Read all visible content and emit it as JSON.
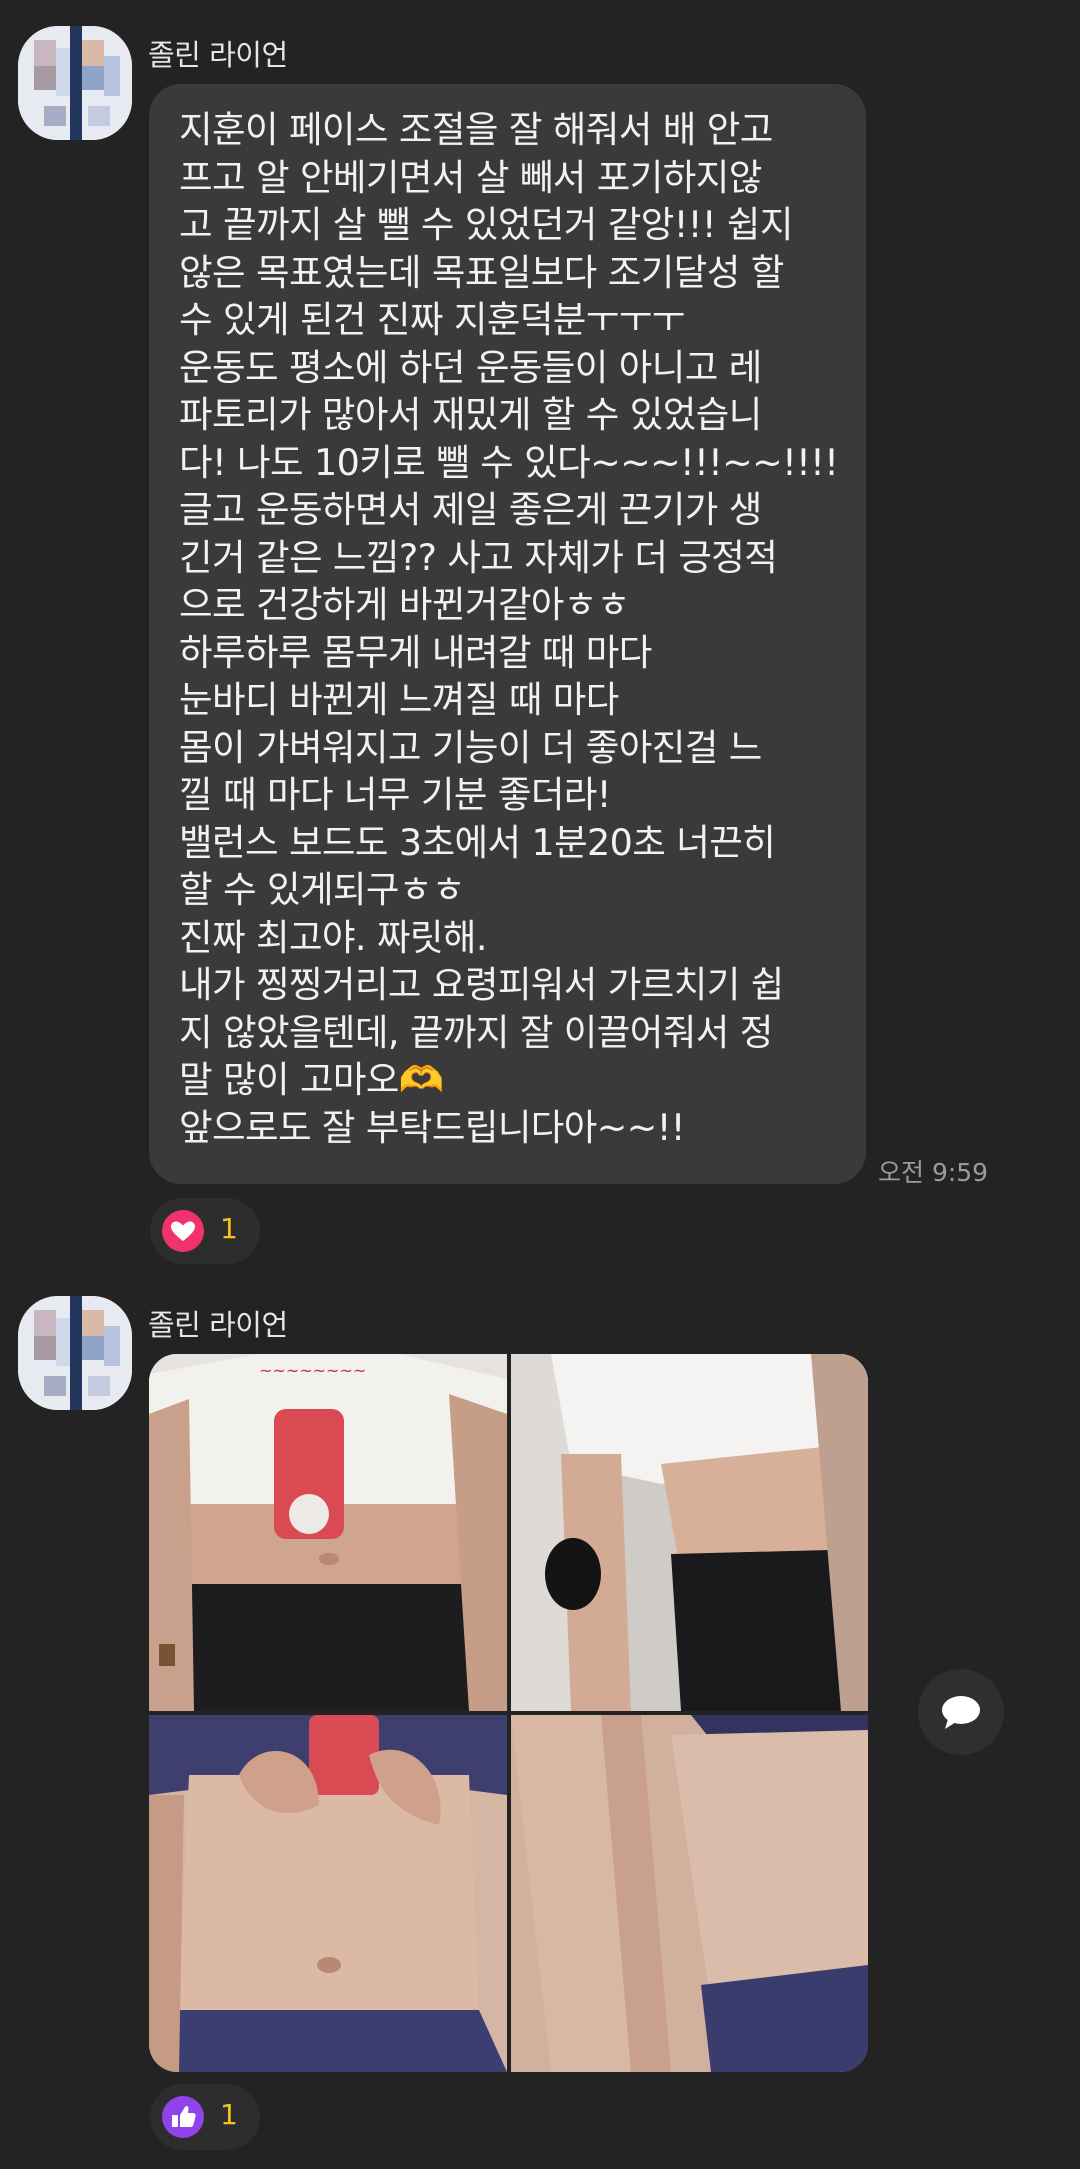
{
  "messages": [
    {
      "sender": "졸린 라이언",
      "lines": [
        "지훈이 페이스 조절을 잘 해줘서 배 안고",
        "프고 알 안베기면서 살 빼서 포기하지않",
        "고 끝까지 살 뺄 수 있었던거 같앙!!! 쉽지",
        "않은 목표였는데 목표일보다 조기달성 할",
        "수 있게 된건 진짜 지훈덕분ㅜㅜㅜ",
        "운동도 평소에 하던 운동들이 아니고 레",
        "파토리가 많아서 재밌게 할 수 있었습니",
        "다! 나도 10키로 뺄 수 있다~~~!!!~~!!!!",
        "글고 운동하면서 제일 좋은게 끈기가 생",
        "긴거 같은 느낌?? 사고 자체가 더 긍정적",
        "으로 건강하게 바뀐거같아ㅎㅎ",
        "하루하루 몸무게 내려갈 때 마다",
        "눈바디 바뀐게 느껴질 때 마다",
        "몸이 가벼워지고 기능이 더 좋아진걸 느",
        "낄 때 마다 너무 기분 좋더라!",
        "밸런스 보드도 3초에서 1분20초 너끈히",
        "할 수 있게되구ㅎㅎ",
        "진짜 최고야. 짜릿해.",
        "내가 찡찡거리고 요령피워서 가르치기 쉽",
        "지 않았을텐데, 끝까지 잘 이끌어줘서 정",
        "말 많이 고마오🫶",
        "앞으로도 잘 부탁드립니다아~~!!"
      ],
      "time": "오전 9:59",
      "reaction": {
        "icon": "heart-icon",
        "count": "1",
        "color": "#f0336d"
      }
    },
    {
      "sender": "졸린 라이언",
      "photos": [
        {
          "name": "photo-front-before"
        },
        {
          "name": "photo-side-before"
        },
        {
          "name": "photo-front-after"
        },
        {
          "name": "photo-side-after"
        }
      ],
      "reaction": {
        "icon": "thumbs-up-icon",
        "count": "1",
        "color": "#8f43e8"
      }
    }
  ],
  "actions": {
    "comment_icon": "speech-bubble-icon"
  }
}
